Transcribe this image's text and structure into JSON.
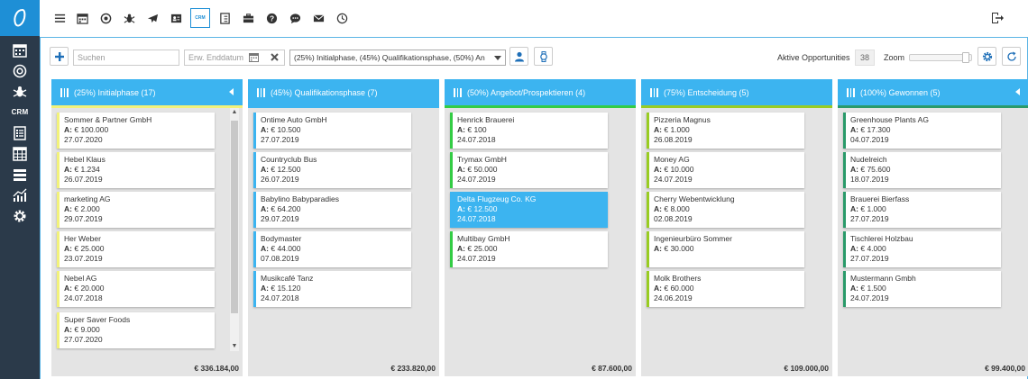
{
  "sidebar": {
    "crm_label": "CRM"
  },
  "topbar": {
    "crm_tag": "CRM"
  },
  "toolbar": {
    "search_placeholder": "Suchen",
    "date_placeholder": "Erw. Enddatum",
    "phase_filter": "(25%) Initialphase, (45%) Qualifikationsphase, (50%) An",
    "active_label": "Aktive Opportunities",
    "active_count": "38",
    "zoom_label": "Zoom"
  },
  "colors": {
    "accent": "#3cb4f0",
    "sidebar": "#2b3a4a"
  },
  "columns": [
    {
      "title": "(25%) Initialphase (17)",
      "bar_color": "#f2f27a",
      "total": "€ 336.184,00",
      "cards": [
        {
          "name": "Sommer & Partner GmbH",
          "amount_prefix": "A:",
          "amount": "€ 100.000",
          "date": "27.07.2020"
        },
        {
          "name": "Hebel Klaus",
          "amount_prefix": "A:",
          "amount": "€ 1.234",
          "date": "26.07.2019"
        },
        {
          "name": "marketing AG",
          "amount_prefix": "A:",
          "amount": "€ 2.000",
          "date": "29.07.2019"
        },
        {
          "name": "Her Weber",
          "amount_prefix": "A:",
          "amount": "€ 25.000",
          "date": "23.07.2019"
        },
        {
          "name": "Nebel AG",
          "amount_prefix": "A:",
          "amount": "€ 20.000",
          "date": "24.07.2018"
        },
        {
          "name": "Super Saver Foods",
          "amount_prefix": "A:",
          "amount": "€ 9.000",
          "date": "27.07.2020"
        }
      ]
    },
    {
      "title": "(45%) Qualifikationsphase (7)",
      "bar_color": "#3cb4f0",
      "total": "€ 233.820,00",
      "cards": [
        {
          "name": "Ontime Auto GmbH",
          "amount_prefix": "A:",
          "amount": "€ 10.500",
          "date": "27.07.2019"
        },
        {
          "name": "Countryclub Bus",
          "amount_prefix": "A:",
          "amount": "€ 12.500",
          "date": "26.07.2019"
        },
        {
          "name": "Babylino Babyparadies",
          "amount_prefix": "A:",
          "amount": "€ 64.200",
          "date": "29.07.2019"
        },
        {
          "name": "Bodymaster",
          "amount_prefix": "A:",
          "amount": "€ 44.000",
          "date": "07.08.2019"
        },
        {
          "name": "Musikcafé Tanz",
          "amount_prefix": "A:",
          "amount": "€ 15.120",
          "date": "24.07.2018"
        }
      ]
    },
    {
      "title": "(50%) Angebot/Prospektieren (4)",
      "bar_color": "#33cc44",
      "total": "€ 87.600,00",
      "cards": [
        {
          "name": "Henrick Brauerei",
          "amount_prefix": "A:",
          "amount": "€ 100",
          "date": "24.07.2018"
        },
        {
          "name": "Trymax GmbH",
          "amount_prefix": "A:",
          "amount": "€ 50.000",
          "date": "24.07.2019"
        },
        {
          "name": "Delta Flugzeug Co. KG",
          "amount_prefix": "A:",
          "amount": "€ 12.500",
          "date": "24.07.2018",
          "selected": true
        },
        {
          "name": "Multibay GmbH",
          "amount_prefix": "A:",
          "amount": "€ 25.000",
          "date": "24.07.2019"
        }
      ]
    },
    {
      "title": "(75%) Entscheidung (5)",
      "bar_color": "#99cc22",
      "total": "€ 109.000,00",
      "cards": [
        {
          "name": "Pizzeria Magnus",
          "amount_prefix": "A:",
          "amount": "€ 1.000",
          "date": "26.08.2019"
        },
        {
          "name": "Money AG",
          "amount_prefix": "A:",
          "amount": "€ 10.000",
          "date": "24.07.2019"
        },
        {
          "name": "Cherry Webentwicklung",
          "amount_prefix": "A:",
          "amount": "€ 8.000",
          "date": "02.08.2019"
        },
        {
          "name": "Ingenieurbüro Sommer",
          "amount_prefix": "A:",
          "amount": "€ 30.000",
          "date": ""
        },
        {
          "name": "Molk Brothers",
          "amount_prefix": "A:",
          "amount": "€ 60.000",
          "date": "24.06.2019"
        }
      ]
    },
    {
      "title": "(100%) Gewonnen (5)",
      "bar_color": "#2a9a6a",
      "total": "€ 99.400,00",
      "cards": [
        {
          "name": "Greenhouse Plants AG",
          "amount_prefix": "A:",
          "amount": "€ 17.300",
          "date": "04.07.2019"
        },
        {
          "name": "Nudelreich",
          "amount_prefix": "A:",
          "amount": "€ 75.600",
          "date": "18.07.2019"
        },
        {
          "name": "Brauerei Bierfass",
          "amount_prefix": "A:",
          "amount": "€ 1.000",
          "date": "27.07.2019"
        },
        {
          "name": "Tischlerei Holzbau",
          "amount_prefix": "A:",
          "amount": "€ 4.000",
          "date": "27.07.2019"
        },
        {
          "name": "Mustermann Gmbh",
          "amount_prefix": "A:",
          "amount": "€ 1.500",
          "date": "24.07.2019"
        }
      ]
    }
  ]
}
